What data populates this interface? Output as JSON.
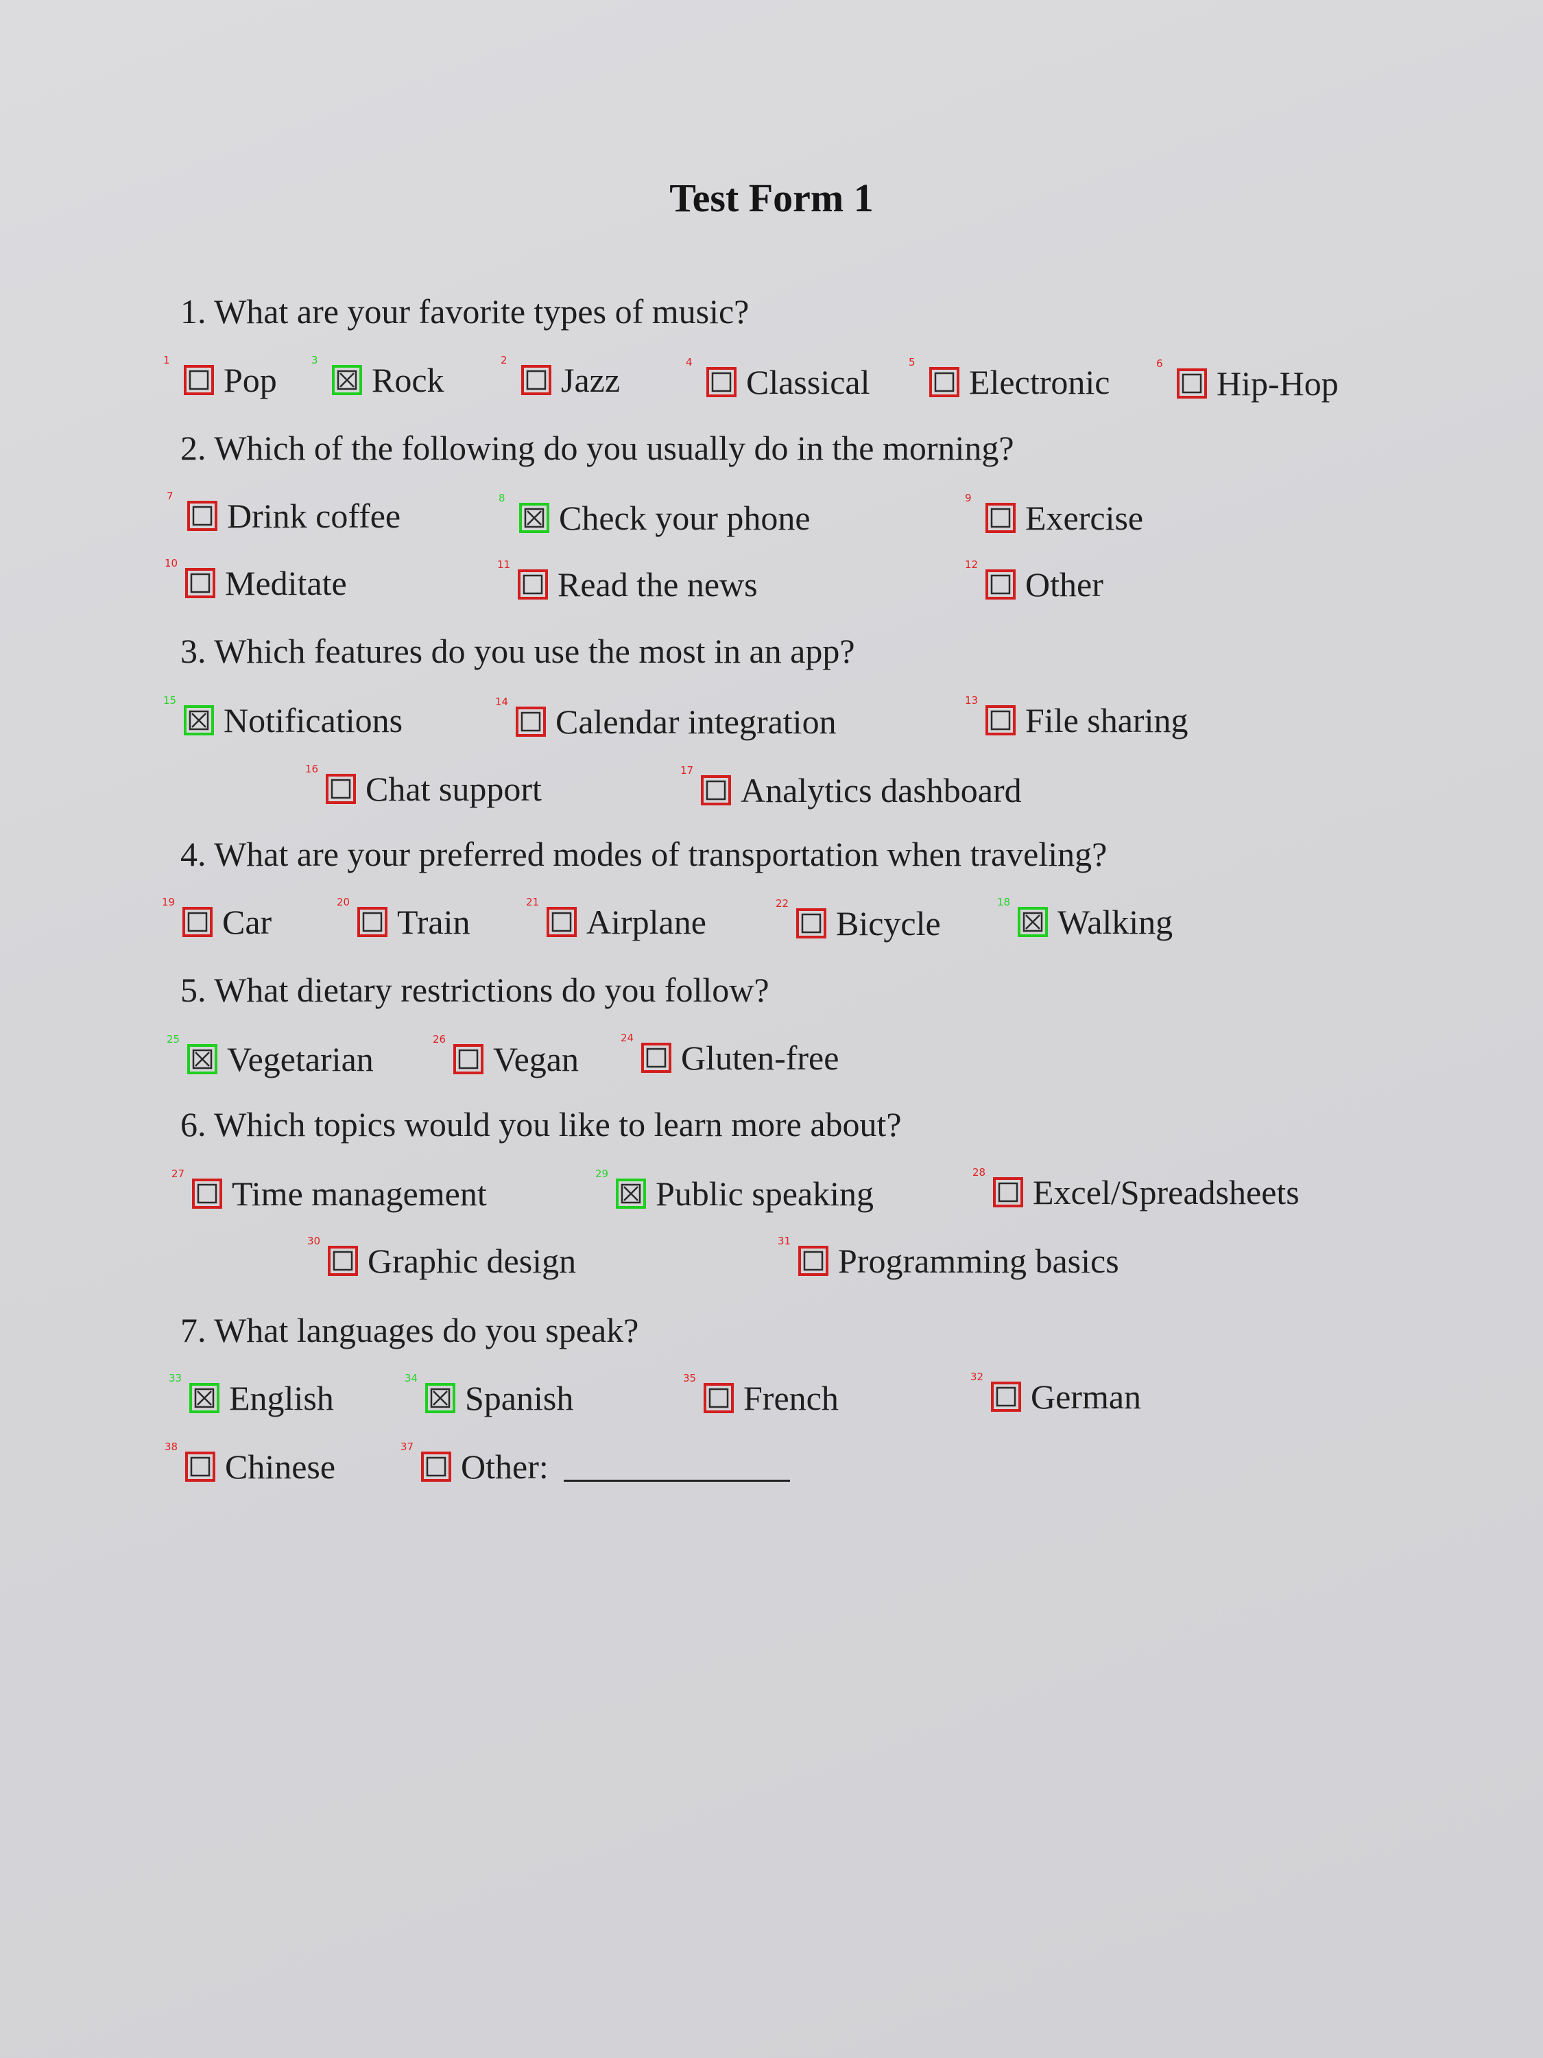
{
  "title": "Test Form 1",
  "questions": [
    {
      "text": "1. What are your favorite types of music?"
    },
    {
      "text": "2. Which of the following do you usually do in the morning?"
    },
    {
      "text": "3. Which features do you use the most in an app?"
    },
    {
      "text": "4. What are your preferred modes of transportation when traveling?"
    },
    {
      "text": "5. What dietary restrictions do you follow?"
    },
    {
      "text": "6. Which topics would you like to learn more about?"
    },
    {
      "text": "7. What languages do you speak?"
    }
  ],
  "options": [
    {
      "num": "1",
      "label": "Pop",
      "checked": false
    },
    {
      "num": "3",
      "label": "Rock",
      "checked": true
    },
    {
      "num": "2",
      "label": "Jazz",
      "checked": false
    },
    {
      "num": "4",
      "label": "Classical",
      "checked": false
    },
    {
      "num": "5",
      "label": "Electronic",
      "checked": false
    },
    {
      "num": "6",
      "label": "Hip-Hop",
      "checked": false
    },
    {
      "num": "7",
      "label": "Drink coffee",
      "checked": false
    },
    {
      "num": "8",
      "label": "Check your phone",
      "checked": true
    },
    {
      "num": "9",
      "label": "Exercise",
      "checked": false
    },
    {
      "num": "10",
      "label": "Meditate",
      "checked": false
    },
    {
      "num": "11",
      "label": "Read the news",
      "checked": false
    },
    {
      "num": "12",
      "label": "Other",
      "checked": false
    },
    {
      "num": "15",
      "label": "Notifications",
      "checked": true
    },
    {
      "num": "14",
      "label": "Calendar integration",
      "checked": false
    },
    {
      "num": "13",
      "label": "File sharing",
      "checked": false
    },
    {
      "num": "16",
      "label": "Chat support",
      "checked": false
    },
    {
      "num": "17",
      "label": "Analytics dashboard",
      "checked": false
    },
    {
      "num": "19",
      "label": "Car",
      "checked": false
    },
    {
      "num": "20",
      "label": "Train",
      "checked": false
    },
    {
      "num": "21",
      "label": "Airplane",
      "checked": false
    },
    {
      "num": "22",
      "label": "Bicycle",
      "checked": false
    },
    {
      "num": "18",
      "label": "Walking",
      "checked": true
    },
    {
      "num": "25",
      "label": "Vegetarian",
      "checked": true
    },
    {
      "num": "26",
      "label": "Vegan",
      "checked": false
    },
    {
      "num": "24",
      "label": "Gluten-free",
      "checked": false
    },
    {
      "num": "27",
      "label": "Time management",
      "checked": false
    },
    {
      "num": "29",
      "label": "Public speaking",
      "checked": true
    },
    {
      "num": "28",
      "label": "Excel/Spreadsheets",
      "checked": false
    },
    {
      "num": "30",
      "label": "Graphic design",
      "checked": false
    },
    {
      "num": "31",
      "label": "Programming basics",
      "checked": false
    },
    {
      "num": "33",
      "label": "English",
      "checked": true
    },
    {
      "num": "34",
      "label": "Spanish",
      "checked": true
    },
    {
      "num": "35",
      "label": "French",
      "checked": false
    },
    {
      "num": "32",
      "label": "German",
      "checked": false
    },
    {
      "num": "38",
      "label": "Chinese",
      "checked": false
    },
    {
      "num": "37",
      "label": "Other:",
      "checked": false
    }
  ],
  "colors": {
    "unchecked_box": "#d41e1e",
    "checked_box": "#1fcf1f",
    "paper": "#d6d6d9",
    "ink": "#1e1e1e"
  }
}
